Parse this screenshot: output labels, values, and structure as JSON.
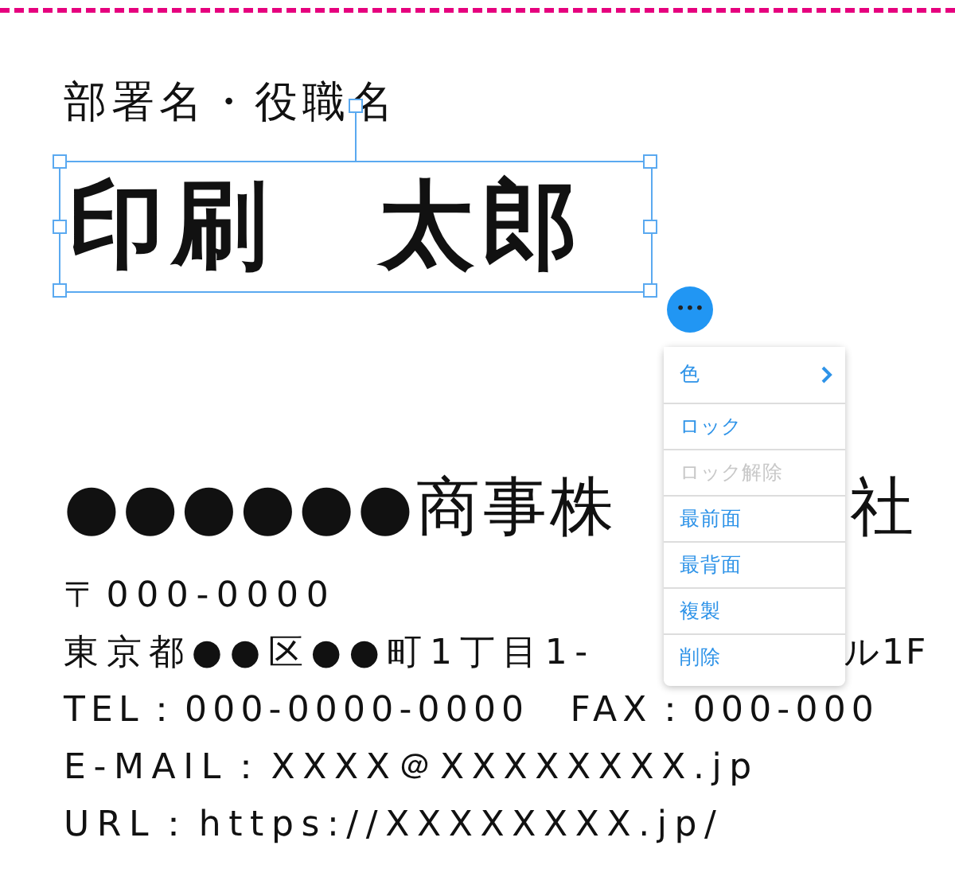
{
  "card": {
    "title": "部署名・役職名",
    "name": "印刷　太郎",
    "selected": true,
    "company": {
      "left": "●●●●●●商事株",
      "right": "社"
    },
    "postal": "〒000-0000",
    "address": {
      "left": "東京都●●区●●町1丁目1-",
      "right": "ル1F"
    },
    "phone": "TEL：000-0000-0000　FAX：000-000",
    "email": "E-MAIL：XXXX＠XXXXXXXX.jp",
    "url": "URL：https://XXXXXXXX.jp/"
  },
  "menu": {
    "button": "•••",
    "items": [
      {
        "label": "色",
        "kind": "submenu",
        "disabled": false
      },
      {
        "label": "ロック",
        "kind": "action",
        "disabled": false
      },
      {
        "label": "ロック解除",
        "kind": "action",
        "disabled": true
      },
      {
        "label": "最前面",
        "kind": "action",
        "disabled": false
      },
      {
        "label": "最背面",
        "kind": "action",
        "disabled": false
      },
      {
        "label": "複製",
        "kind": "action",
        "disabled": false
      },
      {
        "label": "削除",
        "kind": "action",
        "disabled": false
      }
    ]
  }
}
